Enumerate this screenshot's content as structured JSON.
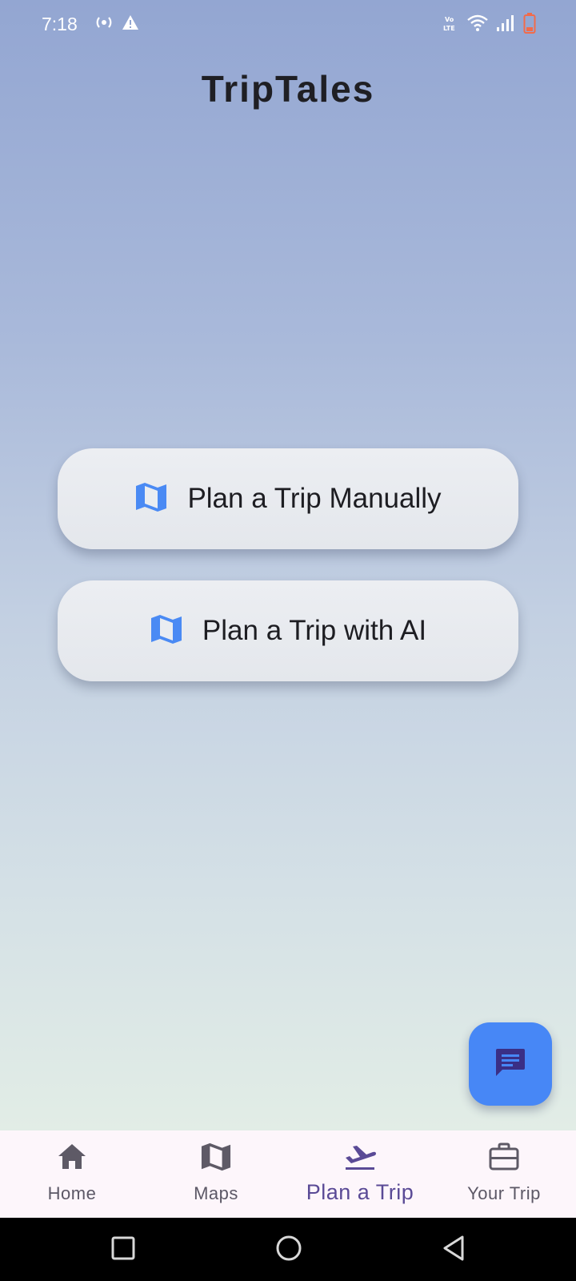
{
  "status_bar": {
    "time": "7:18",
    "left_icons": [
      "hotspot-icon",
      "warning-icon"
    ],
    "right_icons": [
      "volte-icon",
      "wifi-icon",
      "signal-icon",
      "battery-low-icon"
    ],
    "battery_color": "#f26b4a"
  },
  "app": {
    "title": "TripTales"
  },
  "actions": {
    "manual_label": "Plan a Trip Manually",
    "ai_label": "Plan a Trip with AI",
    "icon": "map-icon",
    "icon_color": "#4a8af4"
  },
  "fab": {
    "icon": "chat-icon",
    "color": "#4787f6"
  },
  "bottom_nav": {
    "items": [
      {
        "label": "Home",
        "icon": "home-icon",
        "active": false
      },
      {
        "label": "Maps",
        "icon": "map-icon",
        "active": false
      },
      {
        "label": "Plan a Trip",
        "icon": "flight-takeoff-icon",
        "active": true
      },
      {
        "label": "Your Trip",
        "icon": "briefcase-icon",
        "active": false
      }
    ],
    "active_color": "#5a4a96"
  },
  "system_nav": {
    "buttons": [
      "recents-icon",
      "home-circle-icon",
      "back-icon"
    ]
  }
}
